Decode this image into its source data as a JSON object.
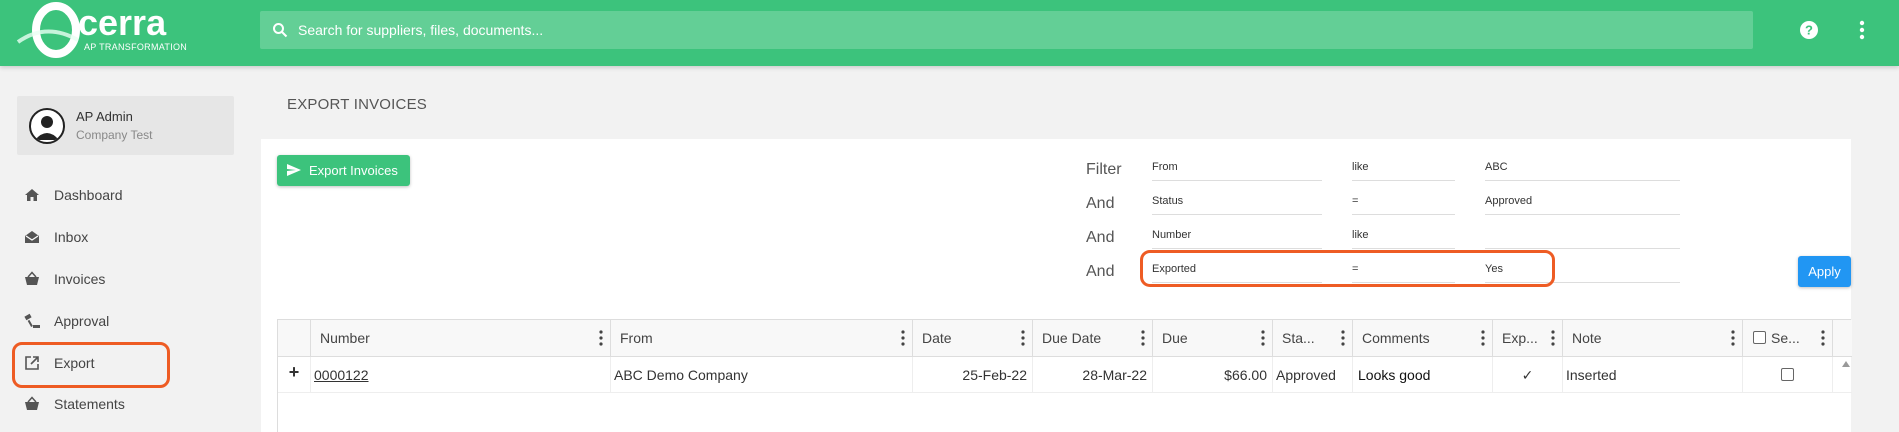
{
  "app": {
    "logo_text": "cerra",
    "logo_sub": "AP TRANSFORMATION"
  },
  "search": {
    "placeholder": "Search for suppliers, files, documents..."
  },
  "user": {
    "name": "AP Admin",
    "company": "Company Test"
  },
  "sidebar": {
    "items": [
      {
        "label": "Dashboard",
        "icon": "home-icon"
      },
      {
        "label": "Inbox",
        "icon": "inbox-icon"
      },
      {
        "label": "Invoices",
        "icon": "basket-icon"
      },
      {
        "label": "Approval",
        "icon": "gavel-icon"
      },
      {
        "label": "Export",
        "icon": "external-link-icon"
      },
      {
        "label": "Statements",
        "icon": "basket-icon"
      }
    ]
  },
  "page": {
    "title": "EXPORT INVOICES"
  },
  "toolbar": {
    "export_label": "Export Invoices",
    "apply_label": "Apply"
  },
  "filters": [
    {
      "conj": "Filter",
      "field": "From",
      "op": "like",
      "value": "ABC"
    },
    {
      "conj": "And",
      "field": "Status",
      "op": "=",
      "value": "Approved"
    },
    {
      "conj": "And",
      "field": "Number",
      "op": "like",
      "value": ""
    },
    {
      "conj": "And",
      "field": "Exported",
      "op": "=",
      "value": "Yes"
    }
  ],
  "grid": {
    "columns": [
      "Number",
      "From",
      "Date",
      "Due Date",
      "Due",
      "Sta...",
      "Comments",
      "Exp...",
      "Note",
      "Se..."
    ],
    "rows": [
      {
        "expand": "+",
        "number": "0000122",
        "from": "ABC Demo Company",
        "date": "25-Feb-22",
        "due_date": "28-Mar-22",
        "due": "$66.00",
        "status": "Approved",
        "comments": "Looks good",
        "exported": "✓",
        "note": "Inserted"
      }
    ]
  },
  "colors": {
    "brand": "#3cc37c",
    "apply": "#2196f3",
    "highlight": "#ee5c24"
  }
}
